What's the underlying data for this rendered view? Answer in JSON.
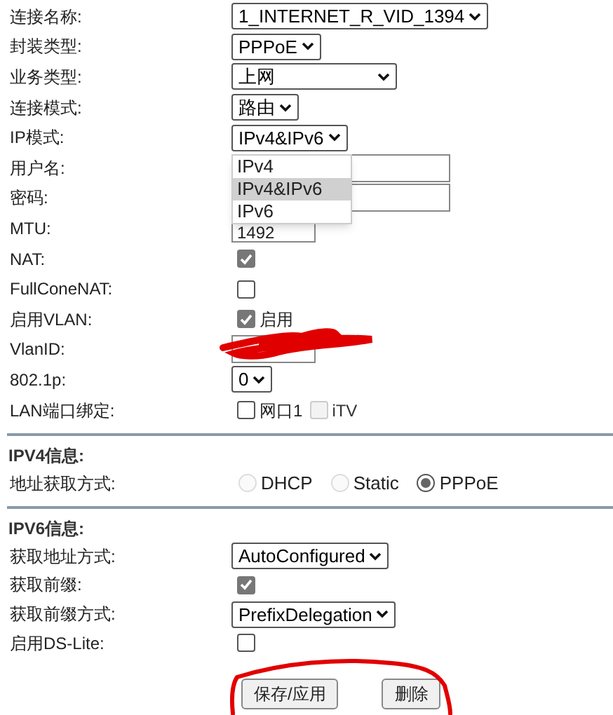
{
  "general": {
    "rows": [
      {
        "kind": "select",
        "label": "连接名称:",
        "value": "1_INTERNET_R_VID_1394"
      },
      {
        "kind": "select",
        "label": "封装类型:",
        "value": "PPPoE"
      },
      {
        "kind": "select",
        "label": "业务类型:",
        "value": "上网",
        "wide": true
      },
      {
        "kind": "select",
        "label": "连接模式:",
        "value": "路由"
      },
      {
        "kind": "select",
        "label": "IP模式:",
        "value": "IPv4&IPv6",
        "expanded": true,
        "options": [
          {
            "label": "IPv4",
            "selected": false
          },
          {
            "label": "IPv4&IPv6",
            "selected": true
          },
          {
            "label": "IPv6",
            "selected": false
          }
        ]
      },
      {
        "kind": "text",
        "label": "用户名:"
      },
      {
        "kind": "text",
        "label": "密码:"
      },
      {
        "kind": "short_text",
        "label": "MTU:",
        "value": "1492"
      },
      {
        "kind": "checkbox",
        "label": "NAT:",
        "checked": true
      },
      {
        "kind": "checkbox",
        "label": "FullConeNAT:",
        "checked": false
      },
      {
        "kind": "checkbox",
        "label": "启用VLAN:",
        "checked": true,
        "caption": "启用"
      },
      {
        "kind": "short_text",
        "label": "VlanID:",
        "scribbled": true
      },
      {
        "kind": "select",
        "label": "802.1p:",
        "value": "0"
      },
      {
        "kind": "checkbox_group",
        "label": "LAN端口绑定:",
        "items": [
          {
            "label": "网口1",
            "checked": false,
            "disabled": false
          },
          {
            "label": "iTV",
            "checked": false,
            "disabled": true
          }
        ]
      }
    ]
  },
  "sections": [
    {
      "title": "IPV4信息:",
      "rows": [
        {
          "kind": "radio_group",
          "label": "地址获取方式:",
          "items": [
            {
              "label": "DHCP",
              "selected": false
            },
            {
              "label": "Static",
              "selected": false
            },
            {
              "label": "PPPoE",
              "selected": true
            }
          ]
        }
      ]
    },
    {
      "title": "IPV6信息:",
      "rows": [
        {
          "kind": "select",
          "label": "获取地址方式:",
          "value": "AutoConfigured"
        },
        {
          "kind": "checkbox",
          "label": "获取前缀:",
          "checked": true
        },
        {
          "kind": "select",
          "label": "获取前缀方式:",
          "value": "PrefixDelegation"
        },
        {
          "kind": "checkbox",
          "label": "启用DS-Lite:",
          "checked": false
        }
      ]
    }
  ],
  "buttons": [
    {
      "label": "保存/应用"
    },
    {
      "label": "删除"
    }
  ],
  "annotations": {
    "buttons_circled": true
  }
}
